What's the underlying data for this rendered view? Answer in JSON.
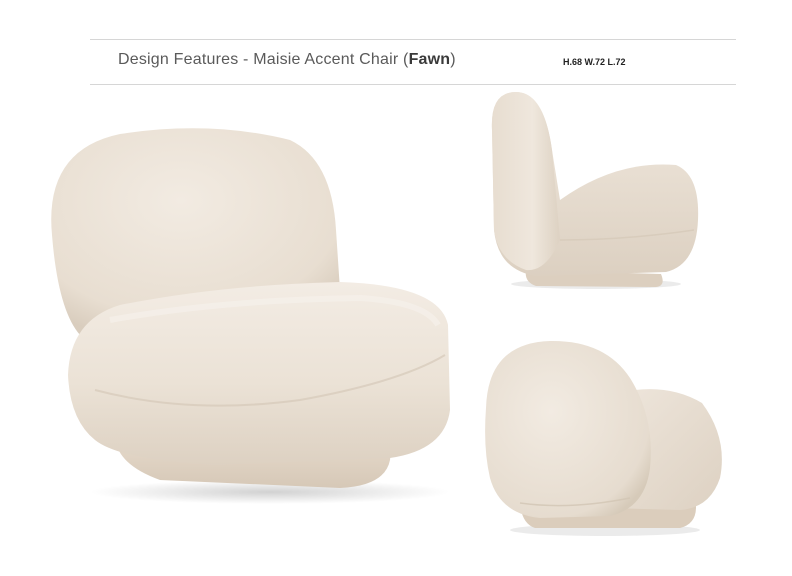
{
  "header": {
    "title_prefix": "Design Features - Maisie Accent Chair (",
    "variant": "Fawn",
    "title_suffix": ")",
    "dimensions": "H.68 W.72 L.72"
  },
  "colors": {
    "fabric": "#ece3d8",
    "fabric_shadow": "#d8ccbd",
    "fabric_highlight": "#f5efe8",
    "base": "#e2d5c6",
    "rule": "#d6d6d6"
  }
}
